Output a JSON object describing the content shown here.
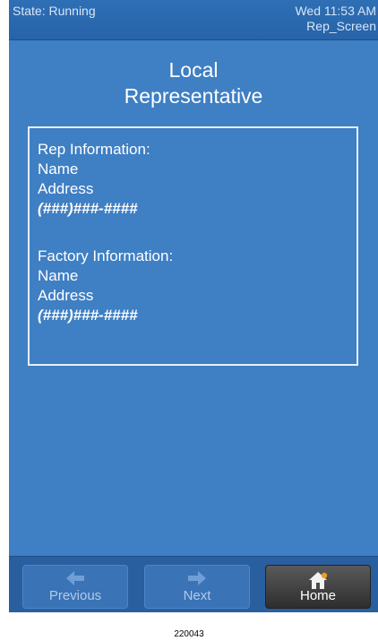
{
  "status": {
    "state": "State: Running",
    "datetime": "Wed 11:53 AM",
    "screen_name": "Rep_Screen"
  },
  "title": {
    "line1": "Local",
    "line2": "Representative"
  },
  "rep_info": {
    "heading": "Rep Information:",
    "name": "Name",
    "address": "Address",
    "phone": "(###)###-####"
  },
  "factory_info": {
    "heading": "Factory Information:",
    "name": "Name",
    "address": "Address",
    "phone": "(###)###-####"
  },
  "nav": {
    "previous": {
      "label": "Previous",
      "icon": "arrow-left-icon",
      "enabled": false
    },
    "next": {
      "label": "Next",
      "icon": "arrow-right-icon",
      "enabled": false
    },
    "home": {
      "label": "Home",
      "icon": "home-icon",
      "enabled": true
    }
  },
  "caption": "220043"
}
